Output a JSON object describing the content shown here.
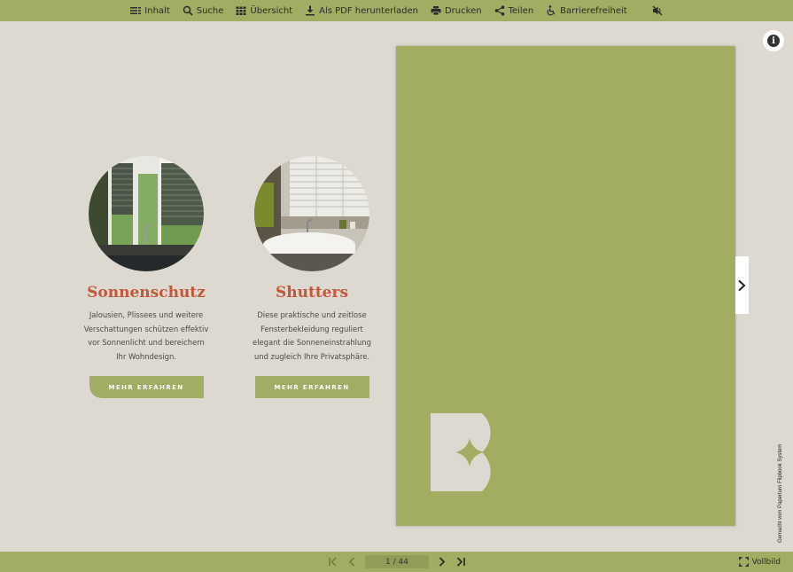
{
  "toolbar": {
    "contents": "Inhalt",
    "search": "Suche",
    "overview": "Übersicht",
    "pdf": "Als PDF herunterladen",
    "print": "Drucken",
    "share": "Teilen",
    "accessibility": "Barrierefreiheit"
  },
  "cards": [
    {
      "title": "Sonnenschutz",
      "desc": [
        "Jalousien, Plissees und weitere",
        "Verschattungen schützen effektiv",
        "vor Sonnenlicht und bereichern",
        "Ihr Wohndesign."
      ],
      "button": "MEHR ERFAHREN"
    },
    {
      "title": "Shutters",
      "desc": [
        "Diese praktische und zeitlose",
        "Fensterbekleidung reguliert",
        "elegant die Sonneneinstrahlung",
        "und zugleich Ihre Privatsphäre."
      ],
      "button": "MEHR ERFAHREN"
    }
  ],
  "credit": "Gemacht vom Paperturn Flipbook System",
  "pagination": {
    "indicator": "1 / 44"
  },
  "fullscreen": "Vollbild",
  "colors": {
    "accent": "#a1ad62",
    "title": "#c2573a",
    "background": "#ddd8d0"
  }
}
